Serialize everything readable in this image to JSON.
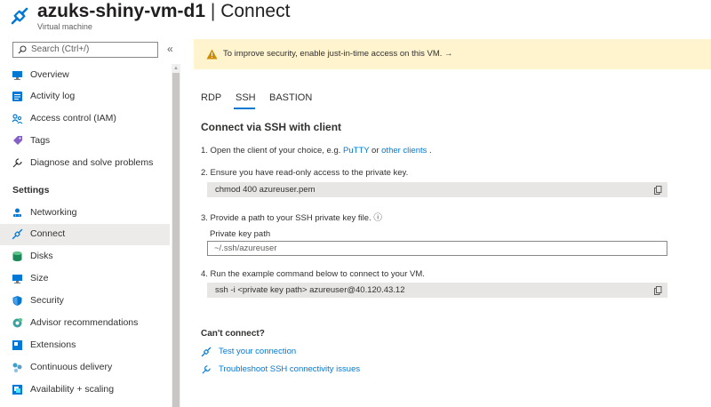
{
  "header": {
    "title": "azuks-shiny-vm-d1",
    "separator": " | ",
    "page": "Connect",
    "subtitle": "Virtual machine"
  },
  "sidebar": {
    "search_placeholder": "Search (Ctrl+/)",
    "collapse_glyph": "«",
    "items_top": [
      {
        "label": "Overview",
        "icon": "monitor-icon"
      },
      {
        "label": "Activity log",
        "icon": "activity-log-icon"
      },
      {
        "label": "Access control (IAM)",
        "icon": "people-icon"
      },
      {
        "label": "Tags",
        "icon": "tag-icon"
      },
      {
        "label": "Diagnose and solve problems",
        "icon": "wrench-icon"
      }
    ],
    "settings_heading": "Settings",
    "items_settings": [
      {
        "label": "Networking",
        "icon": "networking-icon"
      },
      {
        "label": "Connect",
        "icon": "connect-plug-icon",
        "active": true
      },
      {
        "label": "Disks",
        "icon": "disk-icon"
      },
      {
        "label": "Size",
        "icon": "monitor-icon"
      },
      {
        "label": "Security",
        "icon": "shield-icon"
      },
      {
        "label": "Advisor recommendations",
        "icon": "advisor-icon"
      },
      {
        "label": "Extensions",
        "icon": "extensions-icon"
      },
      {
        "label": "Continuous delivery",
        "icon": "continuous-delivery-icon"
      },
      {
        "label": "Availability + scaling",
        "icon": "availability-icon"
      }
    ]
  },
  "banner": {
    "text": "To improve security, enable just-in-time access on this VM. →"
  },
  "tabs": [
    "RDP",
    "SSH",
    "BASTION"
  ],
  "active_tab": "SSH",
  "ssh": {
    "section_title": "Connect via SSH with client",
    "step1_prefix": "1. Open the client of your choice, e.g. ",
    "step1_link1": "PuTTY",
    "step1_or": " or ",
    "step1_link2": "other clients",
    "step1_suffix": " .",
    "step2": "2. Ensure you have read-only access to the private key.",
    "step2_command": "chmod 400 azureuser.pem",
    "step3": "3. Provide a path to your SSH private key file. ⓘ",
    "key_path_label": "Private key path",
    "key_path_value": "~/.ssh/azureuser",
    "step4": "4. Run the example command below to connect to your VM.",
    "step4_command": "ssh -i <private key path> azureuser@40.120.43.12"
  },
  "help": {
    "heading": "Can't connect?",
    "test_link": "Test your connection",
    "troubleshoot_link": "Troubleshoot SSH connectivity issues"
  },
  "colors": {
    "accent": "#0078d4",
    "banner_bg": "#fff4ce",
    "warning": "#d18c00",
    "active_nav_bg": "#edebe9",
    "code_bg": "#e7e6e5"
  }
}
